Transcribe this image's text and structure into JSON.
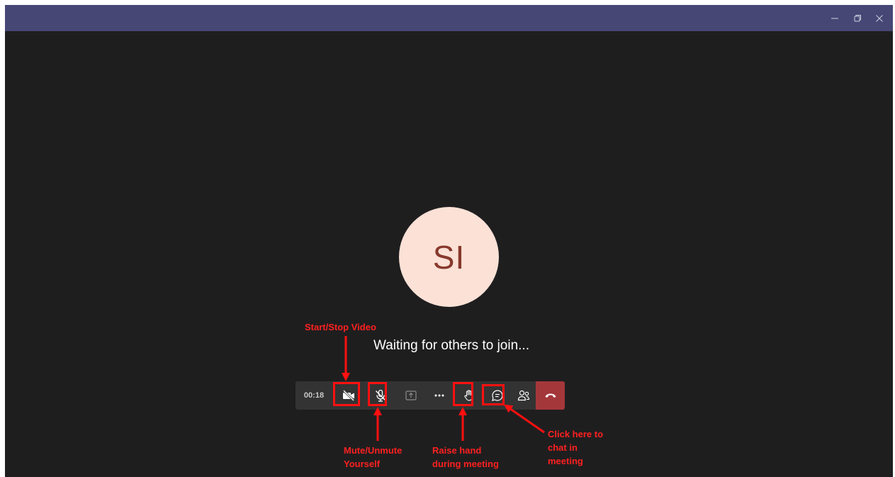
{
  "window": {
    "controls": {
      "minimize": "minimize-icon",
      "restore": "restore-icon",
      "close": "close-icon"
    }
  },
  "avatar": {
    "initials": "SI"
  },
  "status": {
    "waiting": "Waiting for others to join..."
  },
  "toolbar": {
    "timer": "00:18",
    "buttons": [
      {
        "name": "video",
        "icon": "video-off-icon"
      },
      {
        "name": "mic",
        "icon": "mic-off-icon"
      },
      {
        "name": "share",
        "icon": "share-tray-icon"
      },
      {
        "name": "more",
        "icon": "more-icon"
      },
      {
        "name": "raise-hand",
        "icon": "hand-icon"
      },
      {
        "name": "chat",
        "icon": "chat-icon"
      },
      {
        "name": "participants",
        "icon": "people-icon"
      },
      {
        "name": "leave",
        "icon": "hang-up-icon"
      }
    ]
  },
  "annotations": {
    "video": "Start/Stop Video",
    "mute_line1": "Mute/Unmute",
    "mute_line2": "Yourself",
    "hand_line1": "Raise hand",
    "hand_line2": "during meeting",
    "chat_line1": "Click here to",
    "chat_line2": "chat in",
    "chat_line3": "meeting"
  },
  "colors": {
    "titlebar": "#464775",
    "stage": "#1f1e1f",
    "toolbar": "#333333",
    "leave": "#a4373a",
    "avatar_bg": "#fbe1d6",
    "avatar_text": "#87392c",
    "annotation": "#ff2020"
  }
}
